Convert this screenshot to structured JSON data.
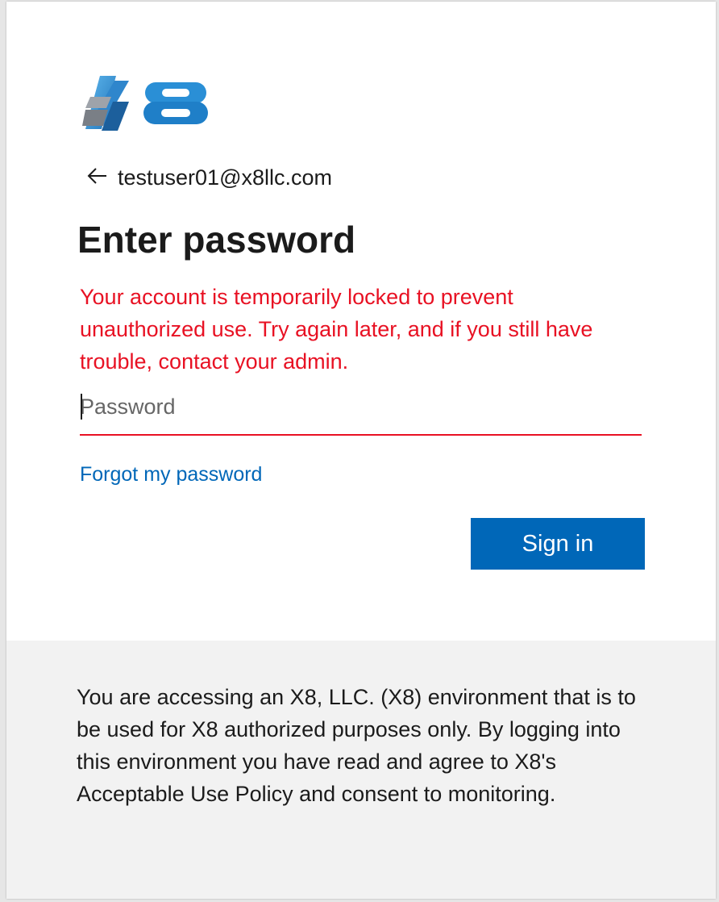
{
  "identity": {
    "email": "testuser01@x8llc.com"
  },
  "title": "Enter password",
  "error_message": "Your account is temporarily locked to prevent unauthorized use. Try again later, and if you still have trouble, contact your admin.",
  "password_field": {
    "placeholder": "Password",
    "value": ""
  },
  "forgot_password_link": "Forgot my password",
  "sign_in_button": "Sign in",
  "footer_notice": "You are accessing an X8, LLC. (X8) environment that is to be used for X8 authorized purposes only. By logging into this environment you have read and agree to X8's Acceptable Use Policy and consent to monitoring.",
  "icons": {
    "logo": "x8-logo",
    "back": "arrow-left-icon"
  },
  "colors": {
    "accent_blue": "#0067b8",
    "error_red": "#e81123",
    "logo_blue": "#2a8fd6",
    "footer_bg": "#f2f2f2"
  }
}
